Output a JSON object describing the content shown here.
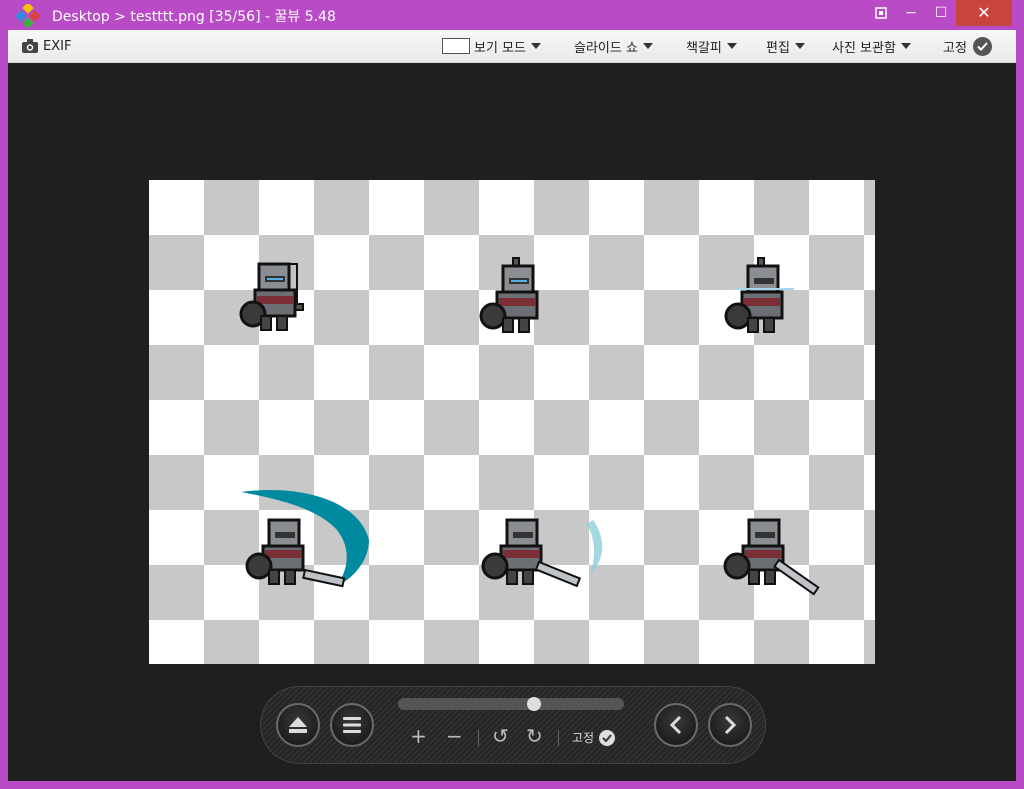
{
  "window": {
    "title": "Desktop > testttt.png [35/56] - 꿀뷰 5.48",
    "controls": {
      "minimize": "−",
      "maximize": "☐",
      "close": "✕"
    }
  },
  "menubar": {
    "exif_label": "EXIF",
    "items": [
      {
        "label": "보기 모드"
      },
      {
        "label": "슬라이드 쇼"
      },
      {
        "label": "책갈피"
      },
      {
        "label": "편집"
      },
      {
        "label": "사진 보관함"
      }
    ],
    "pin_label": "고정"
  },
  "viewer": {
    "background": "#1f1f1f",
    "image_checker_colors": [
      "#ffffff",
      "#c8c8c8"
    ],
    "sprites": [
      {
        "name": "knight-idle-sword-up",
        "row": 1,
        "col": 1
      },
      {
        "name": "knight-idle",
        "row": 1,
        "col": 2
      },
      {
        "name": "knight-idle-glow",
        "row": 1,
        "col": 3
      },
      {
        "name": "knight-attack-slash-big",
        "row": 2,
        "col": 1
      },
      {
        "name": "knight-attack-slash-faded",
        "row": 2,
        "col": 2
      },
      {
        "name": "knight-attack-sword-down",
        "row": 2,
        "col": 3
      }
    ],
    "slash_color": "#008aa0"
  },
  "controls": {
    "eject_icon": "eject-icon",
    "menu_icon": "hamburger-icon",
    "zoom_in": "+",
    "zoom_out": "−",
    "rotate_left": "↺",
    "rotate_right": "↻",
    "pin_label": "고정",
    "prev_icon": "chevron-left-icon",
    "next_icon": "chevron-right-icon",
    "slider_position_fraction": 0.61
  },
  "colors": {
    "window_frame": "#b94bc6",
    "close_button": "#c8453b"
  }
}
